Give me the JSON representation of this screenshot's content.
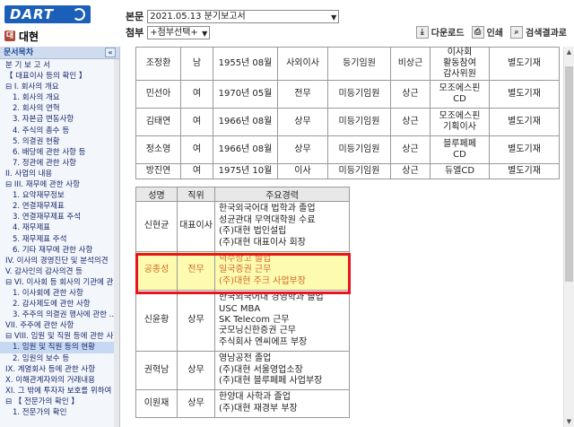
{
  "header": {
    "logo_text": "DART",
    "company_icon": "대",
    "company_name": "대현",
    "report_label": "본문",
    "report_value": "2021.05.13  분기보고서",
    "attach_label": "첨부",
    "attach_value": "+첨부선택+",
    "buttons": {
      "download": "다운로드",
      "print": "인쇄",
      "search": "검색결과로"
    }
  },
  "sidebar": {
    "title": "문서목차",
    "collapse": "«",
    "items": [
      {
        "label": "분 기 보 고 서",
        "level": 0
      },
      {
        "label": "【 대표이사 등의 확인 】",
        "level": 0
      },
      {
        "label": "⊟ I. 회사의 개요",
        "level": 0
      },
      {
        "label": "1. 회사의 개요",
        "level": 1
      },
      {
        "label": "2. 회사의 연혁",
        "level": 1
      },
      {
        "label": "3. 자본금 변동사항",
        "level": 1
      },
      {
        "label": "4. 주식의 총수 등",
        "level": 1
      },
      {
        "label": "5. 의결권 현황",
        "level": 1
      },
      {
        "label": "6. 배당에 관한 사항 등",
        "level": 1
      },
      {
        "label": "7. 정관에 관한 사항",
        "level": 1
      },
      {
        "label": "II. 사업의 내용",
        "level": 0
      },
      {
        "label": "⊟ III. 재무에 관한 사항",
        "level": 0
      },
      {
        "label": "1. 요약재무정보",
        "level": 1
      },
      {
        "label": "2. 연결재무제표",
        "level": 1
      },
      {
        "label": "3. 연결재무제표 주석",
        "level": 1
      },
      {
        "label": "4. 재무제표",
        "level": 1
      },
      {
        "label": "5. 재무제표 주석",
        "level": 1
      },
      {
        "label": "6. 기타 재무에 관한 사항",
        "level": 1
      },
      {
        "label": "IV. 이사의 경영진단 및 분석의견",
        "level": 0
      },
      {
        "label": "V. 감사인의 감사의견 등",
        "level": 0
      },
      {
        "label": "⊟ VI. 이사회 등 회사의 기관에 관한",
        "level": 0
      },
      {
        "label": "1. 이사회에 관한 사항",
        "level": 1
      },
      {
        "label": "2. 감사제도에 관한 사항",
        "level": 1
      },
      {
        "label": "3. 주주의 의결권 행사에 관한 ...",
        "level": 1
      },
      {
        "label": "VII. 주주에 관한 사항",
        "level": 0
      },
      {
        "label": "⊟ VIII. 임원 및 직원 등에 관한 사항",
        "level": 0
      },
      {
        "label": "1. 임원 및 직원 등의 현황",
        "level": 1,
        "selected": true
      },
      {
        "label": "2. 임원의 보수 등",
        "level": 1
      },
      {
        "label": "IX. 계열회사 등에 관한 사항",
        "level": 0
      },
      {
        "label": "X. 이해관계자와의 거래내용",
        "level": 0
      },
      {
        "label": "XI. 그 밖에 투자자 보호를 위하여",
        "level": 0
      },
      {
        "label": "⊟ 【 전문가의 확인 】",
        "level": 0
      },
      {
        "label": "1. 전문가의 확인",
        "level": 1
      }
    ]
  },
  "exec_table": {
    "rows": [
      {
        "name": "조정환",
        "gender": "남",
        "birth": "1955년 08월",
        "position": "사외이사",
        "type": "등기임원",
        "fulltime": "비상근",
        "duty": "이사회\n활동참여\n감사위원",
        "note": "별도기재"
      },
      {
        "name": "민선아",
        "gender": "여",
        "birth": "1970년 05월",
        "position": "전무",
        "type": "미등기임원",
        "fulltime": "상근",
        "duty": "모조에스핀\nCD",
        "note": "별도기재"
      },
      {
        "name": "김태연",
        "gender": "여",
        "birth": "1966년 08월",
        "position": "상무",
        "type": "미등기임원",
        "fulltime": "상근",
        "duty": "모조에스핀\n기획이사",
        "note": "별도기재"
      },
      {
        "name": "정소영",
        "gender": "여",
        "birth": "1966년 08월",
        "position": "상무",
        "type": "미등기임원",
        "fulltime": "상근",
        "duty": "블루페페\nCD",
        "note": "별도기재"
      },
      {
        "name": "방진연",
        "gender": "여",
        "birth": "1975년 10월",
        "position": "이사",
        "type": "미등기임원",
        "fulltime": "상근",
        "duty": "듀엘CD",
        "note": "별도기재"
      }
    ]
  },
  "career_table": {
    "headers": [
      "성명",
      "직위",
      "주요경력"
    ],
    "rows": [
      {
        "name": "신현균",
        "position": "대표이사",
        "career": [
          "한국외국어대 법학과 졸업",
          "성균관대 무역대학원 수료",
          "(주)대현 법인설립",
          "(주)대현 대표이사 회장"
        ],
        "highlight": false
      },
      {
        "name": "공종성",
        "position": "전무",
        "career": [
          "덕수상고 졸업",
          "일국증권 근무",
          "(주)대현 주크 사업부장"
        ],
        "highlight": true
      },
      {
        "name": "신윤황",
        "position": "상무",
        "career": [
          "한국외국어대 경영학과 졸업",
          "USC MBA",
          "SK Telecom 근무",
          "굿모닝신한증권 근무",
          "주식회사 엔씨에프 부장"
        ],
        "highlight": false
      },
      {
        "name": "권혁남",
        "position": "상무",
        "career": [
          "영남공전 졸업",
          "(주)대현 서울영업소장",
          "(주)대현 블루페페 사업부장"
        ],
        "highlight": false
      },
      {
        "name": "이원재",
        "position": "상무",
        "career": [
          "한양대 사학과 졸업",
          "(주)대현 재경부 부장"
        ],
        "highlight": false
      }
    ]
  },
  "colors": {
    "highlight_box": "#e8141e",
    "highlight_fill": "#fcfbb0",
    "highlight_text": "#d2692a",
    "logo": "#1c5fb8"
  }
}
